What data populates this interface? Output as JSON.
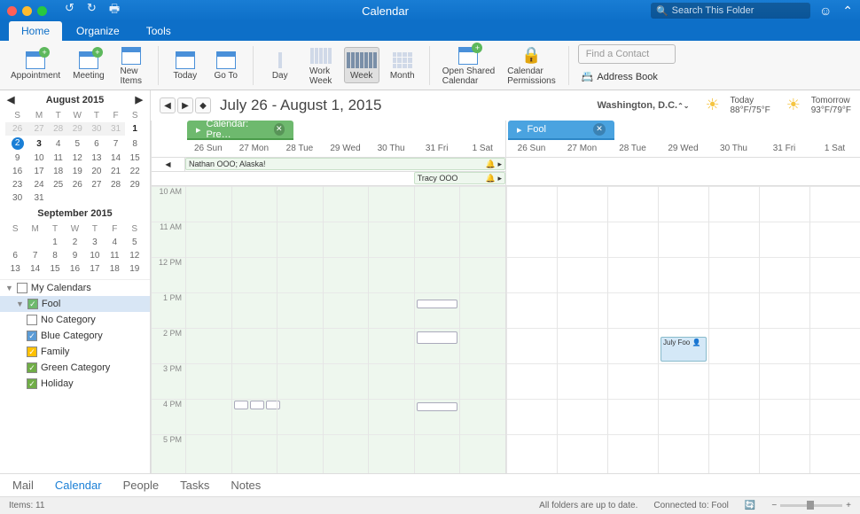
{
  "window": {
    "title": "Calendar",
    "search_placeholder": "Search This Folder"
  },
  "tabs": [
    "Home",
    "Organize",
    "Tools"
  ],
  "ribbon": {
    "appointment": "Appointment",
    "meeting": "Meeting",
    "newitems": "New\nItems",
    "today": "Today",
    "goto": "Go To",
    "day": "Day",
    "workweek": "Work\nWeek",
    "week": "Week",
    "month": "Month",
    "openshared": "Open Shared\nCalendar",
    "perms": "Calendar\nPermissions",
    "findcontact_ph": "Find a Contact",
    "addrbook": "Address Book"
  },
  "minical1": {
    "title": "August 2015",
    "dow": [
      "S",
      "M",
      "T",
      "W",
      "T",
      "F",
      "S"
    ],
    "rows": [
      [
        {
          "d": "26",
          "o": 1
        },
        {
          "d": "27",
          "o": 1
        },
        {
          "d": "28",
          "o": 1
        },
        {
          "d": "29",
          "o": 1
        },
        {
          "d": "30",
          "o": 1
        },
        {
          "d": "31",
          "o": 1
        },
        {
          "d": "1",
          "b": 1
        }
      ],
      [
        {
          "d": "2",
          "t": 1
        },
        {
          "d": "3",
          "b": 1
        },
        {
          "d": "4"
        },
        {
          "d": "5"
        },
        {
          "d": "6"
        },
        {
          "d": "7"
        },
        {
          "d": "8"
        }
      ],
      [
        {
          "d": "9"
        },
        {
          "d": "10"
        },
        {
          "d": "11"
        },
        {
          "d": "12"
        },
        {
          "d": "13"
        },
        {
          "d": "14"
        },
        {
          "d": "15"
        }
      ],
      [
        {
          "d": "16"
        },
        {
          "d": "17"
        },
        {
          "d": "18"
        },
        {
          "d": "19"
        },
        {
          "d": "20"
        },
        {
          "d": "21"
        },
        {
          "d": "22"
        }
      ],
      [
        {
          "d": "23"
        },
        {
          "d": "24"
        },
        {
          "d": "25"
        },
        {
          "d": "26"
        },
        {
          "d": "27"
        },
        {
          "d": "28"
        },
        {
          "d": "29"
        }
      ],
      [
        {
          "d": "30"
        },
        {
          "d": "31"
        },
        {
          "d": ""
        },
        {
          "d": ""
        },
        {
          "d": ""
        },
        {
          "d": ""
        },
        {
          "d": ""
        }
      ]
    ]
  },
  "minical2": {
    "title": "September 2015",
    "dow": [
      "S",
      "M",
      "T",
      "W",
      "T",
      "F",
      "S"
    ],
    "rows": [
      [
        {
          "d": ""
        },
        {
          "d": ""
        },
        {
          "d": "1"
        },
        {
          "d": "2"
        },
        {
          "d": "3"
        },
        {
          "d": "4"
        },
        {
          "d": "5"
        }
      ],
      [
        {
          "d": "6"
        },
        {
          "d": "7"
        },
        {
          "d": "8"
        },
        {
          "d": "9"
        },
        {
          "d": "10"
        },
        {
          "d": "11"
        },
        {
          "d": "12"
        }
      ],
      [
        {
          "d": "13"
        },
        {
          "d": "14"
        },
        {
          "d": "15"
        },
        {
          "d": "16"
        },
        {
          "d": "17"
        },
        {
          "d": "18"
        },
        {
          "d": "19"
        }
      ]
    ]
  },
  "caltree": {
    "mycal": "My Calendars",
    "fool": "Fool",
    "cats": [
      "No Category",
      "Blue Category",
      "Family",
      "Green Category",
      "Holiday"
    ],
    "catcolors": [
      "#fff",
      "#5b9bd5",
      "#ffc000",
      "#70ad47",
      "#70ad47"
    ]
  },
  "header": {
    "range": "July 26 - August 1, 2015",
    "loc": "Washington,  D.C.",
    "today_lbl": "Today",
    "today_temp": "88°F/75°F",
    "tom_lbl": "Tomorrow",
    "tom_temp": "93°F/79°F"
  },
  "panes": {
    "left": {
      "label": "Calendar: Pre…",
      "days": [
        [
          "26",
          "Sun"
        ],
        [
          "27",
          "Mon"
        ],
        [
          "28",
          "Tue"
        ],
        [
          "29",
          "Wed"
        ],
        [
          "30",
          "Thu"
        ],
        [
          "31",
          "Fri"
        ],
        [
          "1",
          "Sat"
        ]
      ],
      "allday1": "Nathan OOO; Alaska!",
      "allday2": "Tracy OOO"
    },
    "right": {
      "label": "Fool",
      "days": [
        [
          "26",
          "Sun"
        ],
        [
          "27",
          "Mon"
        ],
        [
          "28",
          "Tue"
        ],
        [
          "29",
          "Wed"
        ],
        [
          "30",
          "Thu"
        ],
        [
          "31",
          "Fri"
        ],
        [
          "1",
          "Sat"
        ]
      ],
      "event": "July Foo"
    }
  },
  "hours": [
    "10 AM",
    "11 AM",
    "12 PM",
    "1 PM",
    "2 PM",
    "3 PM",
    "4 PM",
    "5 PM"
  ],
  "viewbar": [
    "Mail",
    "Calendar",
    "People",
    "Tasks",
    "Notes"
  ],
  "status": {
    "items": "Items: 11",
    "sync": "All folders are up to date.",
    "conn": "Connected to: Fool"
  }
}
